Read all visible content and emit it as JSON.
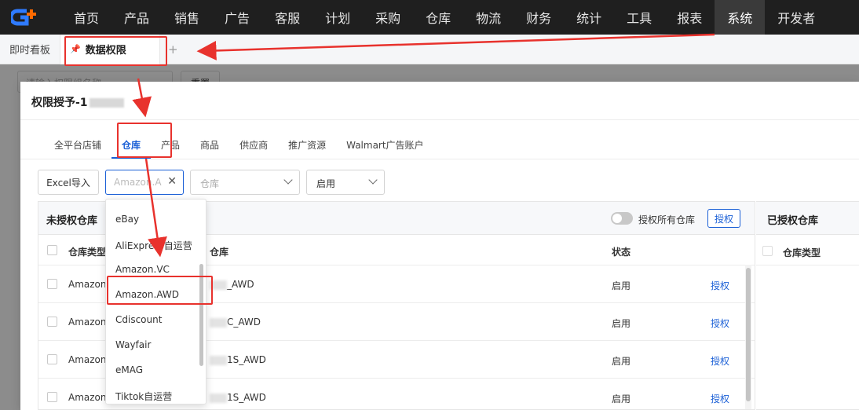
{
  "topnav": {
    "items": [
      "首页",
      "产品",
      "销售",
      "广告",
      "客服",
      "计划",
      "采购",
      "仓库",
      "物流",
      "财务",
      "统计",
      "工具",
      "报表",
      "系统",
      "开发者"
    ],
    "active_index": 13
  },
  "tabbar": {
    "tabs": [
      {
        "label": "即时看板",
        "active": false
      },
      {
        "label": "数据权限",
        "active": true
      }
    ],
    "add_label": "+"
  },
  "background_page": {
    "search_placeholder": "请输入权限组名称",
    "reset_label": "重置"
  },
  "modal": {
    "title": "权限授予-1",
    "subtabs": [
      "全平台店铺",
      "仓库",
      "产品",
      "商品",
      "供应商",
      "推广资源",
      "Walmart广告账户"
    ],
    "active_subtab_index": 1,
    "filters": {
      "excel_button": "Excel导入",
      "platform_value": "Amazon.A",
      "warehouse_placeholder": "仓库",
      "status_value": "启用"
    },
    "unauthorized": {
      "title": "未授权仓库",
      "toggle_label": "授权所有仓库",
      "authorize_button": "授权",
      "columns": [
        "仓库类型",
        "仓库",
        "状态"
      ],
      "rows": [
        {
          "type": "Amazon.A",
          "warehouse": "_AWD",
          "status": "启用",
          "action": "授权"
        },
        {
          "type": "Amazon.A",
          "warehouse": "C_AWD",
          "status": "启用",
          "action": "授权"
        },
        {
          "type": "Amazon.A",
          "warehouse": "1S_AWD",
          "status": "启用",
          "action": "授权"
        },
        {
          "type": "Amazon.A",
          "warehouse": "1S_AWD",
          "status": "启用",
          "action": "授权"
        }
      ]
    },
    "authorized": {
      "title": "已授权仓库",
      "columns": [
        "仓库类型"
      ]
    }
  },
  "dropdown": {
    "options": [
      "eBay",
      "AliExpress自运营",
      "Amazon.VC",
      "Amazon.AWD",
      "Cdiscount",
      "Wayfair",
      "eMAG",
      "Tiktok自运营"
    ],
    "highlighted": "Amazon.AWD"
  },
  "colors": {
    "accent": "#1a5fd6",
    "annotation": "#e8322d",
    "nav_bg": "#1f1f1f"
  }
}
